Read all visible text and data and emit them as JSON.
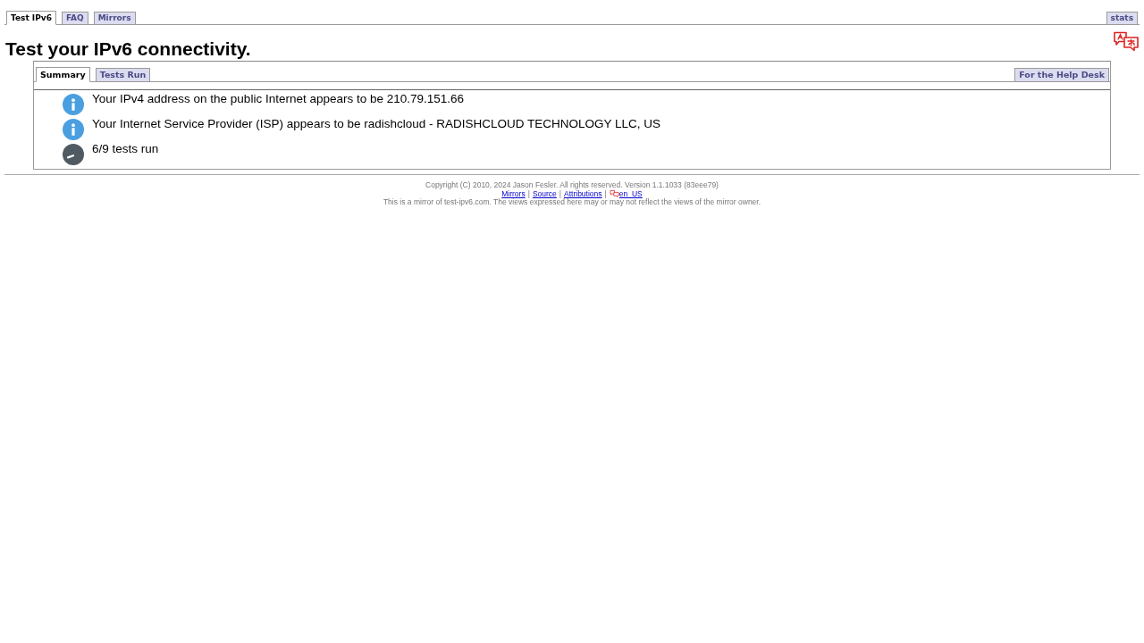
{
  "top_tabs": [
    {
      "label": "Test IPv6",
      "selected": true
    },
    {
      "label": "FAQ",
      "selected": false
    },
    {
      "label": "Mirrors",
      "selected": false
    }
  ],
  "top_right_tabs": [
    {
      "label": "stats",
      "selected": false
    }
  ],
  "heading": "Test your IPv6 connectivity.",
  "panel": {
    "tabs": [
      {
        "label": "Summary",
        "selected": true
      },
      {
        "label": "Tests Run",
        "selected": false
      }
    ],
    "right_tabs": [
      {
        "label": "For the Help Desk",
        "selected": false
      }
    ],
    "rows": [
      {
        "kind": "info",
        "text": "Your IPv4 address on the public Internet appears to be 210.79.151.66"
      },
      {
        "kind": "info",
        "text": "Your Internet Service Provider (ISP) appears to be radishcloud - RADISHCLOUD TECHNOLOGY LLC, US"
      },
      {
        "kind": "progress",
        "text": "6/9 tests run"
      }
    ]
  },
  "footer": {
    "copyright": "Copyright (C) 2010, 2024 Jason Fesler. All rights reserved. Version 1.1.1033 (83eee79)",
    "links": [
      {
        "kind": "link",
        "label": "Mirrors"
      },
      {
        "kind": "separator",
        "label": "|"
      },
      {
        "kind": "link",
        "label": "Source"
      },
      {
        "kind": "separator",
        "label": "|"
      },
      {
        "kind": "link",
        "label": "Attributions"
      },
      {
        "kind": "separator",
        "label": "|"
      },
      {
        "kind": "locale",
        "label": "en_US"
      }
    ],
    "mirror_note": "This is a mirror of test-ipv6.com. The views expressed here may or may not reflect the views of the mirror owner."
  }
}
